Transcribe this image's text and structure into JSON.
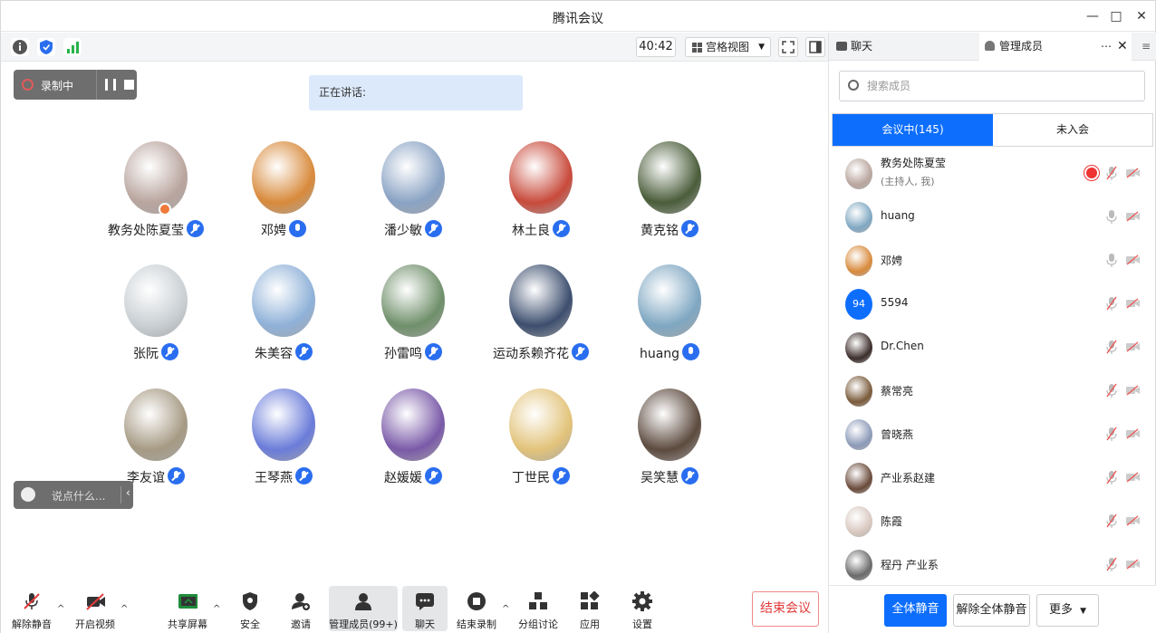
{
  "window": {
    "title": "腾讯会议"
  },
  "toolbar": {
    "timer": "40:42",
    "view_label": "宫格视图"
  },
  "recording": {
    "label": "录制中"
  },
  "speaking": {
    "label": "正在讲话:"
  },
  "participants": [
    {
      "name": "教务处陈夏莹",
      "mic": "muted",
      "host": true,
      "color": "#b9a59e"
    },
    {
      "name": "邓娉",
      "mic": "on",
      "color": "#d88a3b"
    },
    {
      "name": "潘少敏",
      "mic": "muted",
      "color": "#8aa3c4"
    },
    {
      "name": "林土良",
      "mic": "muted",
      "color": "#c84a3b"
    },
    {
      "name": "黄克铭",
      "mic": "muted",
      "color": "#4a5d3a"
    },
    {
      "name": "张阮",
      "mic": "muted",
      "color": "#c9cfd3"
    },
    {
      "name": "朱美容",
      "mic": "muted",
      "color": "#8fb1d8"
    },
    {
      "name": "孙雷鸣",
      "mic": "muted",
      "color": "#6f8f6a"
    },
    {
      "name": "运动系赖齐花",
      "mic": "muted",
      "color": "#3c4e6e"
    },
    {
      "name": "huang",
      "mic": "on",
      "color": "#7fa7c2"
    },
    {
      "name": "李友谊",
      "mic": "muted",
      "color": "#a69a84"
    },
    {
      "name": "王琴燕",
      "mic": "muted",
      "color": "#6a7cd9"
    },
    {
      "name": "赵媛媛",
      "mic": "muted",
      "color": "#7a5aa8"
    },
    {
      "name": "丁世民",
      "mic": "muted",
      "color": "#e2c37a"
    },
    {
      "name": "吴笑慧",
      "mic": "muted",
      "color": "#5c4a3e"
    }
  ],
  "chat_input": {
    "placeholder": "说点什么..."
  },
  "bottom": {
    "unmute": "解除静音",
    "video": "开启视频",
    "share": "共享屏幕",
    "security": "安全",
    "invite": "邀请",
    "members": "管理成员(99+)",
    "chat": "聊天",
    "stop_rec": "结束录制",
    "breakout": "分组讨论",
    "apps": "应用",
    "settings": "设置",
    "end": "结束会议"
  },
  "panel": {
    "tab_chat": "聊天",
    "tab_members": "管理成员",
    "search_placeholder": "搜索成员",
    "seg_in": "会议中(145)",
    "seg_out": "未入会",
    "members": [
      {
        "name": "教务处陈夏莹",
        "sub": "(主持人, 我)",
        "color": "#b9a59e",
        "rec": true,
        "mic_grey": false
      },
      {
        "name": "huang",
        "color": "#7fa7c2",
        "mic_grey": true
      },
      {
        "name": "邓娉",
        "color": "#d88a3b",
        "mic_grey": true
      },
      {
        "name": "5594",
        "initials": "94",
        "color": "#0d6efd",
        "mic_grey": false
      },
      {
        "name": "Dr.Chen",
        "color": "#3b2d2a",
        "mic_grey": false
      },
      {
        "name": "蔡常亮",
        "color": "#7a5a3a",
        "mic_grey": false
      },
      {
        "name": "曾晓燕",
        "color": "#8c9ab8",
        "mic_grey": false
      },
      {
        "name": "产业系赵建",
        "color": "#6a4a3a",
        "mic_grey": false
      },
      {
        "name": "陈霞",
        "color": "#d8c7bf",
        "mic_grey": false
      },
      {
        "name": "程丹 产业系",
        "color": "#6a6a6a",
        "mic_grey": false
      }
    ],
    "mute_all": "全体静音",
    "unmute_all": "解除全体静音",
    "more": "更多"
  }
}
